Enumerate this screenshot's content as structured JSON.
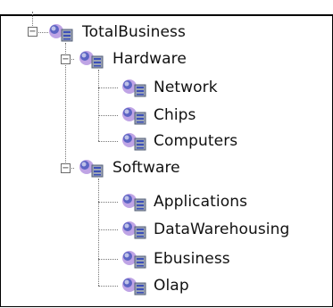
{
  "tree": {
    "root": {
      "label": "TotalBusiness",
      "expander": "−"
    },
    "hardware": {
      "label": "Hardware",
      "expander": "−",
      "children": [
        {
          "label": "Network"
        },
        {
          "label": "Chips"
        },
        {
          "label": "Computers"
        }
      ]
    },
    "software": {
      "label": "Software",
      "expander": "−",
      "children": [
        {
          "label": "Applications"
        },
        {
          "label": "DataWarehousing"
        },
        {
          "label": "Ebusiness"
        },
        {
          "label": "Olap"
        }
      ]
    }
  },
  "colors": {
    "icon_blue": "#3b4fb8",
    "icon_purple": "#8a5ad0",
    "icon_gray": "#9aa2b4"
  },
  "icons": {
    "node": "database-cube-icon",
    "expander": "collapse-toggle-icon"
  }
}
